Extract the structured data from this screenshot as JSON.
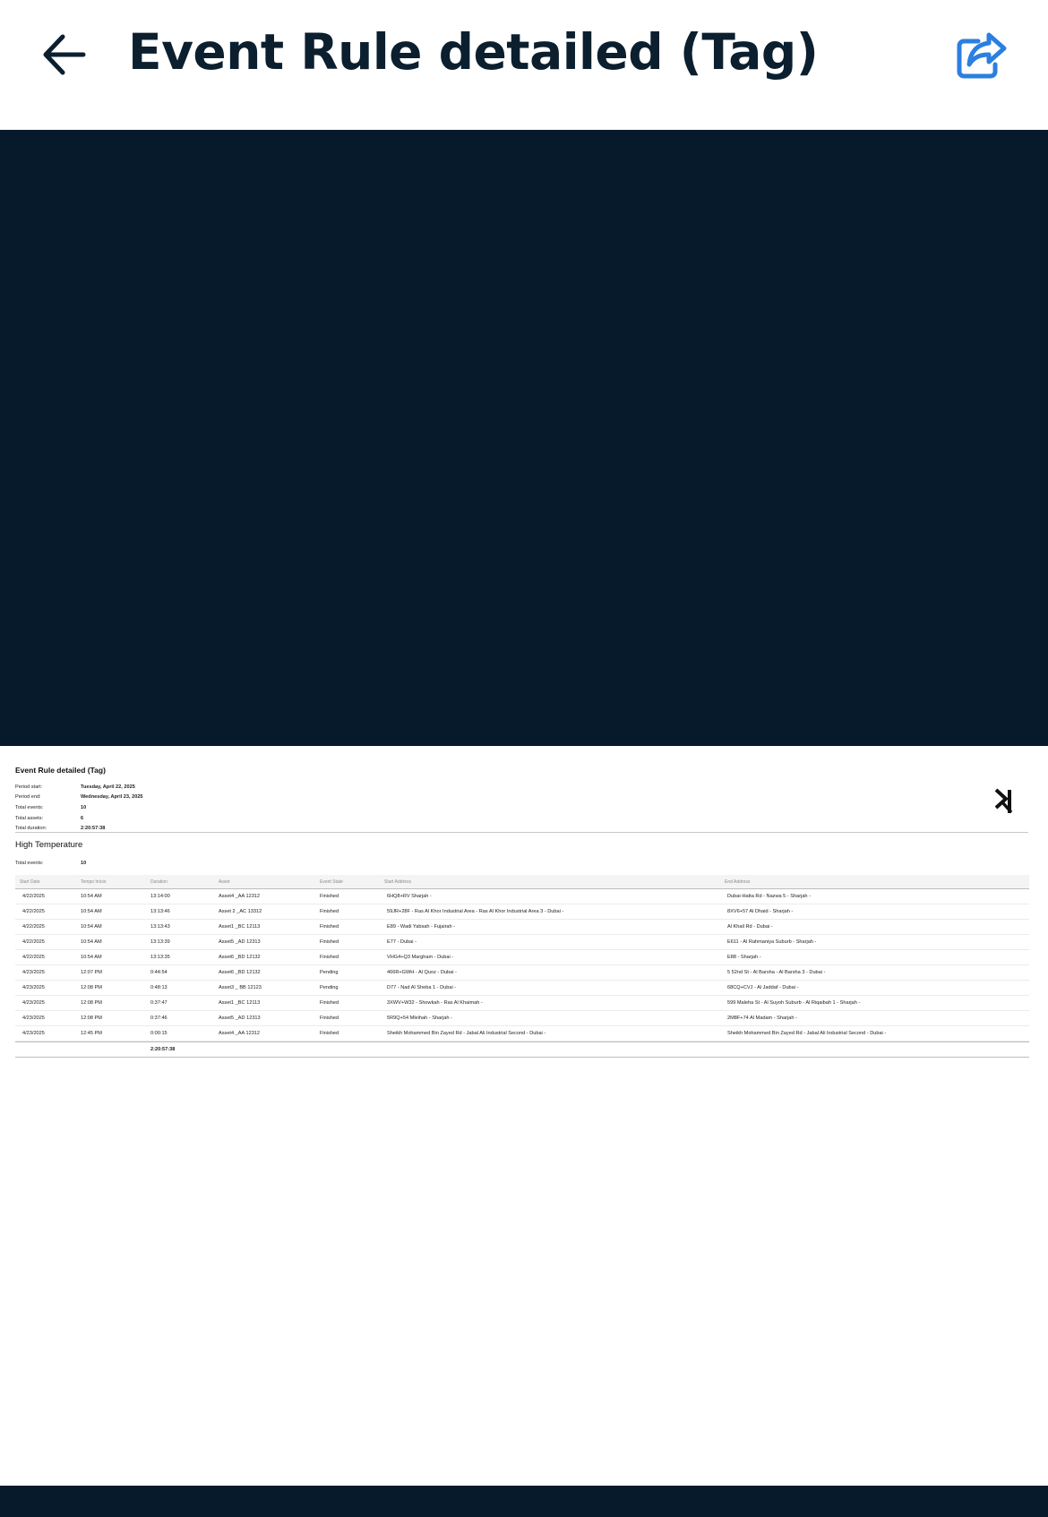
{
  "header": {
    "title": "Event Rule detailed (Tag)",
    "accent_color": "#2b7fe0",
    "back_icon": "arrow-left-icon",
    "share_icon": "share-icon"
  },
  "colors": {
    "dark_background": "#061a2b",
    "title_text": "#0b1f2f"
  },
  "report": {
    "title": "Event Rule detailed (Tag)",
    "meta": [
      {
        "label": "Period start:",
        "value": "Tuesday, April 22, 2025"
      },
      {
        "label": "Period end:",
        "value": "Wednesday, April 23, 2025"
      },
      {
        "label": "Total events:",
        "value": "10"
      },
      {
        "label": "Total assets:",
        "value": "6"
      },
      {
        "label": "Total duration:",
        "value": "2:20:57:38"
      }
    ],
    "section": {
      "title": "High Temperature",
      "total_events_label": "Total events:",
      "total_events_value": "10"
    },
    "table": {
      "columns": [
        "Start Date",
        "Tempo Início",
        "Duration",
        "Asset",
        "Event State",
        "Start Address",
        "End Address"
      ],
      "rows": [
        [
          "4/22/2025",
          "10:54 AM",
          "13:14:00",
          "Asset4 _AA 12312",
          "Finished",
          "6HQ8+RV Sharjah -",
          "Dubai-Hatta Rd - Nazwa 5 - Sharjah -"
        ],
        [
          "4/22/2025",
          "10:54 AM",
          "13:13:46",
          "Asset 2 _AC 13312",
          "Finished",
          "59JR+28F - Ras Al Khor Industrial Area - Ras Al Khor Industrial Area 3 - Dubai -",
          "8XV6+57 Al Dhaid - Sharjah -"
        ],
        [
          "4/22/2025",
          "10:54 AM",
          "13:13:43",
          "Asset1 _BC 12113",
          "Finished",
          "E89 - Wadi Yabsah - Fujairah -",
          "Al Khail Rd - Dubai -"
        ],
        [
          "4/22/2025",
          "10:54 AM",
          "13:13:39",
          "Asset5 _AD 12313",
          "Finished",
          "E77 - Dubai -",
          "E611 - Al Rahmaniya Suburb - Sharjah -"
        ],
        [
          "4/22/2025",
          "10:54 AM",
          "13:13:35",
          "Asset6 _BD 12132",
          "Finished",
          "VHG4+Q3 Margham - Dubai -",
          "E88 - Sharjah -"
        ],
        [
          "4/23/2025",
          "12:07 PM",
          "0:44:54",
          "Asset6 _BD 12132",
          "Pending",
          "466R+GWH - Al Quoz - Dubai -",
          "5 52nd St - Al Barsha - Al Barsha 3 - Dubai -"
        ],
        [
          "4/23/2025",
          "12:08 PM",
          "0:48:13",
          "Asset3 _ BB 12123",
          "Pending",
          "D77 - Nad Al Sheba 1 - Dubai -",
          "68CQ+CVJ - Al Jaddaf - Dubai -"
        ],
        [
          "4/23/2025",
          "12:08 PM",
          "0:37:47",
          "Asset1 _BC 12113",
          "Finished",
          "3XWV+W32 - Showkah - Ras Al Khaimah -",
          "599 Maleha St - Al Suyoh Suburb - Al Riqaibah 1 - Sharjah -"
        ],
        [
          "4/23/2025",
          "12:08 PM",
          "0:37:46",
          "Asset5 _AD 12313",
          "Finished",
          "5R9Q+54 Mleihah - Sharjah -",
          "2M8F+74 Al Madam - Sharjah -"
        ],
        [
          "4/23/2025",
          "12:45 PM",
          "0:00:15",
          "Asset4 _AA 12312",
          "Finished",
          "Sheikh Mohammed Bin Zayed Rd - Jabal Ali Industrial Second - Dubai -",
          "Sheikh Mohammed Bin Zayed Rd - Jabal Ali Industrial Second - Dubai -"
        ]
      ],
      "total_duration": "2:20:57:38"
    }
  }
}
